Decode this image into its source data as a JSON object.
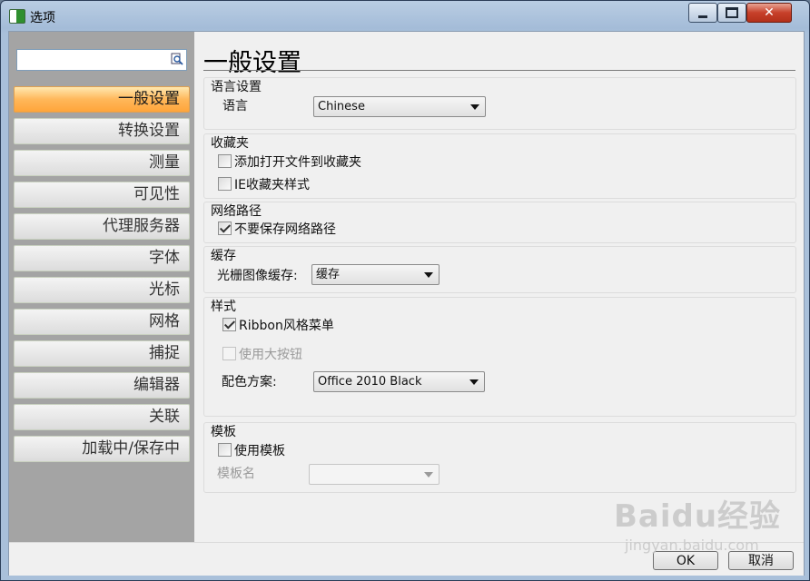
{
  "window": {
    "title": "选项"
  },
  "search": {
    "value": ""
  },
  "sidebar": {
    "items": [
      {
        "label": "一般设置",
        "active": true
      },
      {
        "label": "转换设置"
      },
      {
        "label": "测量"
      },
      {
        "label": "可见性"
      },
      {
        "label": "代理服务器"
      },
      {
        "label": "字体"
      },
      {
        "label": "光标"
      },
      {
        "label": "网格"
      },
      {
        "label": "捕捉"
      },
      {
        "label": "编辑器"
      },
      {
        "label": "关联"
      },
      {
        "label": "加载中/保存中"
      }
    ]
  },
  "page": {
    "title": "一般设置"
  },
  "language": {
    "group": "语言设置",
    "label": "语言",
    "value": "Chinese"
  },
  "favorites": {
    "group": "收藏夹",
    "add_open_files": "添加打开文件到收藏夹",
    "add_open_files_checked": false,
    "ie_style": "IE收藏夹样式",
    "ie_style_checked": false
  },
  "network": {
    "group": "网络路径",
    "dont_save": "不要保存网络路径",
    "dont_save_checked": true
  },
  "cache": {
    "group": "缓存",
    "label": "光栅图像缓存:",
    "value": "缓存"
  },
  "style": {
    "group": "样式",
    "ribbon": "Ribbon风格菜单",
    "ribbon_checked": true,
    "large_buttons": "使用大按钮",
    "large_buttons_checked": false,
    "color_label": "配色方案:",
    "color_value": "Office 2010 Black"
  },
  "template": {
    "group": "模板",
    "use": "使用模板",
    "use_checked": false,
    "name_label": "模板名",
    "name_value": ""
  },
  "buttons": {
    "ok": "OK",
    "cancel": "取消"
  },
  "watermark": {
    "logo": "Baidu经验",
    "url": "jingyan.baidu.com"
  }
}
